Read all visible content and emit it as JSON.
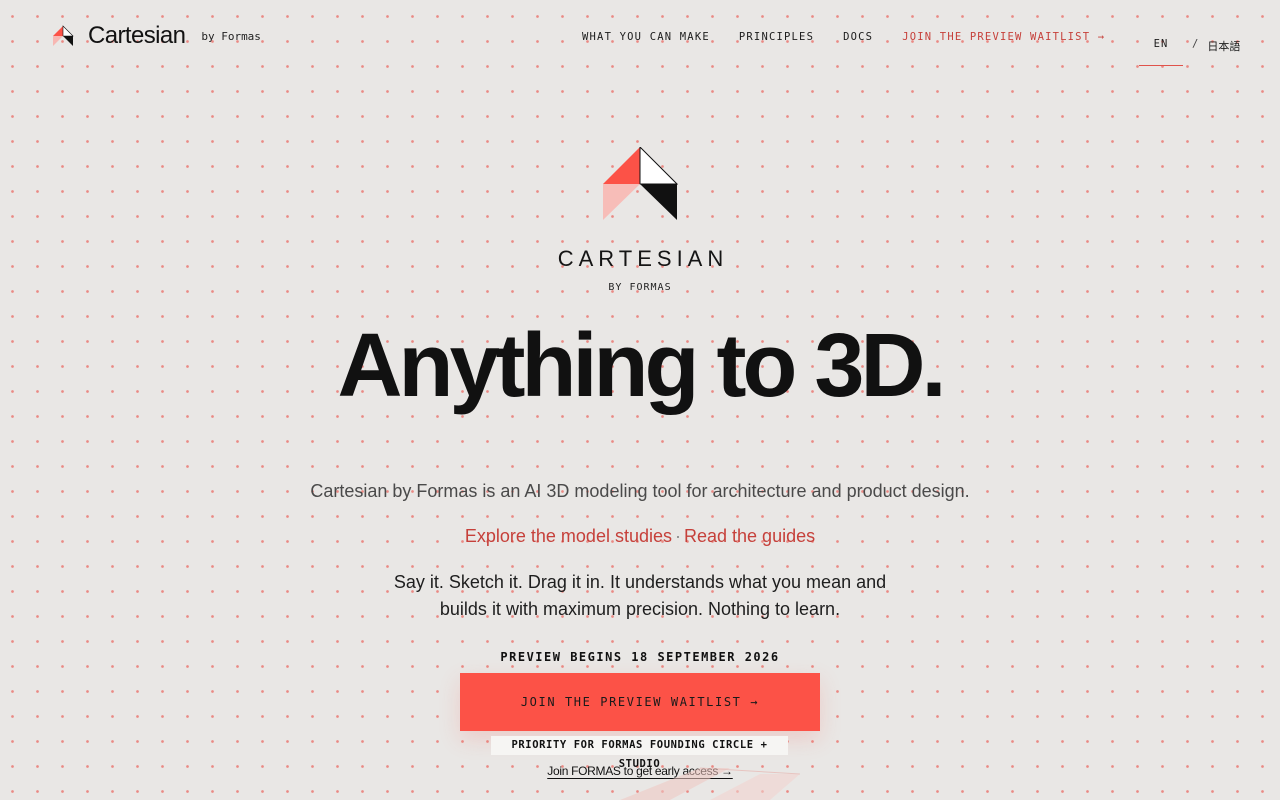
{
  "header": {
    "brand_name": "Cartesian",
    "brand_by": "by Formas",
    "nav": [
      {
        "label": "WHAT YOU CAN MAKE"
      },
      {
        "label": "PRINCIPLES"
      },
      {
        "label": "DOCS"
      },
      {
        "label": "JOIN THE PREVIEW WAITLIST →"
      }
    ],
    "lang": {
      "en": "EN",
      "separator": "/",
      "ja": "日本語",
      "active": "EN"
    }
  },
  "hero": {
    "wordmark": "CARTESIAN",
    "wordmark_by": "BY FORMAS",
    "headline": "Anything to 3D.",
    "tagline": "Cartesian by Formas is an AI 3D modeling tool for architecture and product design.",
    "links": {
      "studies": "Explore the model studies",
      "separator": "·",
      "guides": "Read the guides"
    },
    "pitch_line1": "Say it. Sketch it. Drag it in. It understands what you mean and",
    "pitch_line2": "builds it with maximum precision. Nothing to learn.",
    "preview_date": "PREVIEW BEGINS 18 SEPTEMBER 2026",
    "cta_label": "JOIN THE PREVIEW WAITLIST →",
    "priority_note": "PRIORITY FOR FORMAS FOUNDING CIRCLE + STUDIO",
    "early_access": "Join FORMAS to get early access →"
  },
  "colors": {
    "accent": "#fc5247",
    "accent_text": "#c6403a",
    "background": "#e9e7e5",
    "dots": "#ea8a84"
  },
  "icons": {
    "brand_logo": "cartesian-logo-icon",
    "hero_mark": "cartesian-mark-icon"
  }
}
